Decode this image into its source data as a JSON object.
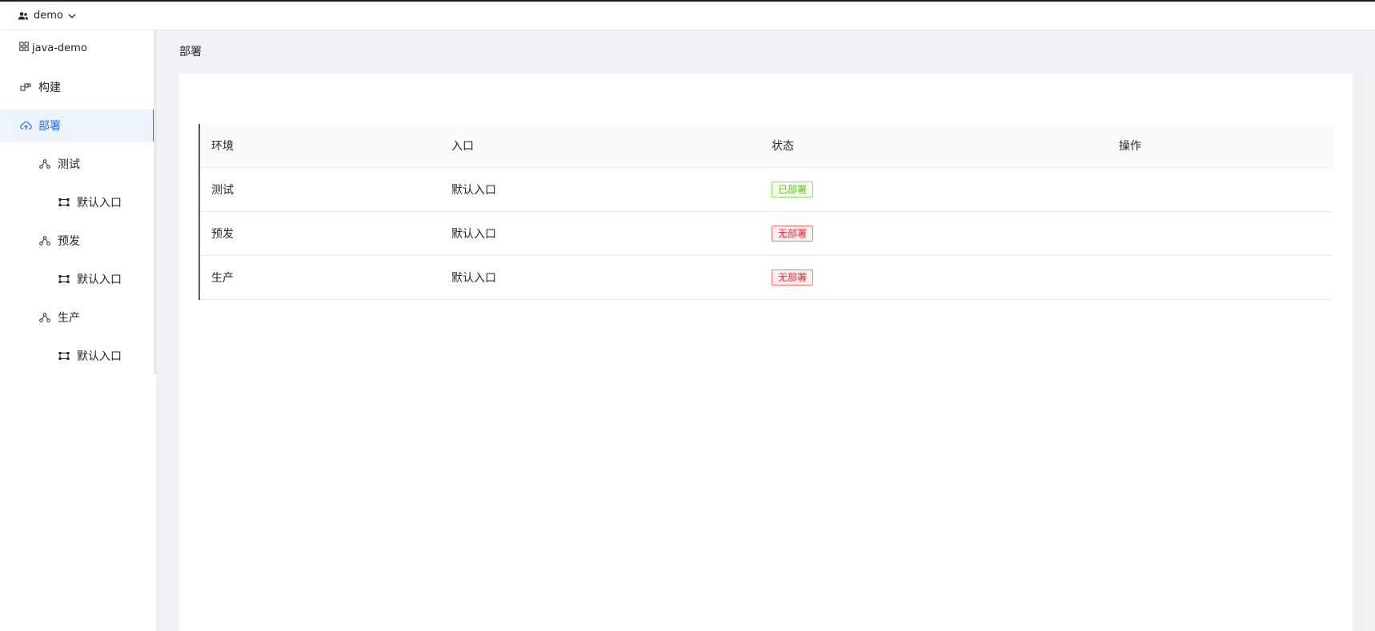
{
  "topbar": {
    "team": "demo"
  },
  "sidebar": {
    "project": "java-demo",
    "items": [
      {
        "label": "构建",
        "icon": "build-icon"
      },
      {
        "label": "部署",
        "icon": "cloud-upload-icon",
        "active": true
      },
      {
        "label": "测试",
        "icon": "cluster-icon"
      },
      {
        "label": "默认入口",
        "icon": "entry-icon"
      },
      {
        "label": "预发",
        "icon": "cluster-icon"
      },
      {
        "label": "默认入口",
        "icon": "entry-icon"
      },
      {
        "label": "生产",
        "icon": "cluster-icon"
      },
      {
        "label": "默认入口",
        "icon": "entry-icon"
      }
    ]
  },
  "main": {
    "title": "部署",
    "table": {
      "headers": [
        "环境",
        "入口",
        "状态",
        "操作"
      ],
      "rows": [
        {
          "env": "测试",
          "entry": "默认入口",
          "status": "已部署",
          "status_type": "ok"
        },
        {
          "env": "预发",
          "entry": "默认入口",
          "status": "无部署",
          "status_type": "no"
        },
        {
          "env": "生产",
          "entry": "默认入口",
          "status": "无部署",
          "status_type": "no"
        }
      ]
    }
  },
  "colors": {
    "accent": "#2f6bff",
    "success": "#52c41a",
    "danger": "#f5222d"
  }
}
